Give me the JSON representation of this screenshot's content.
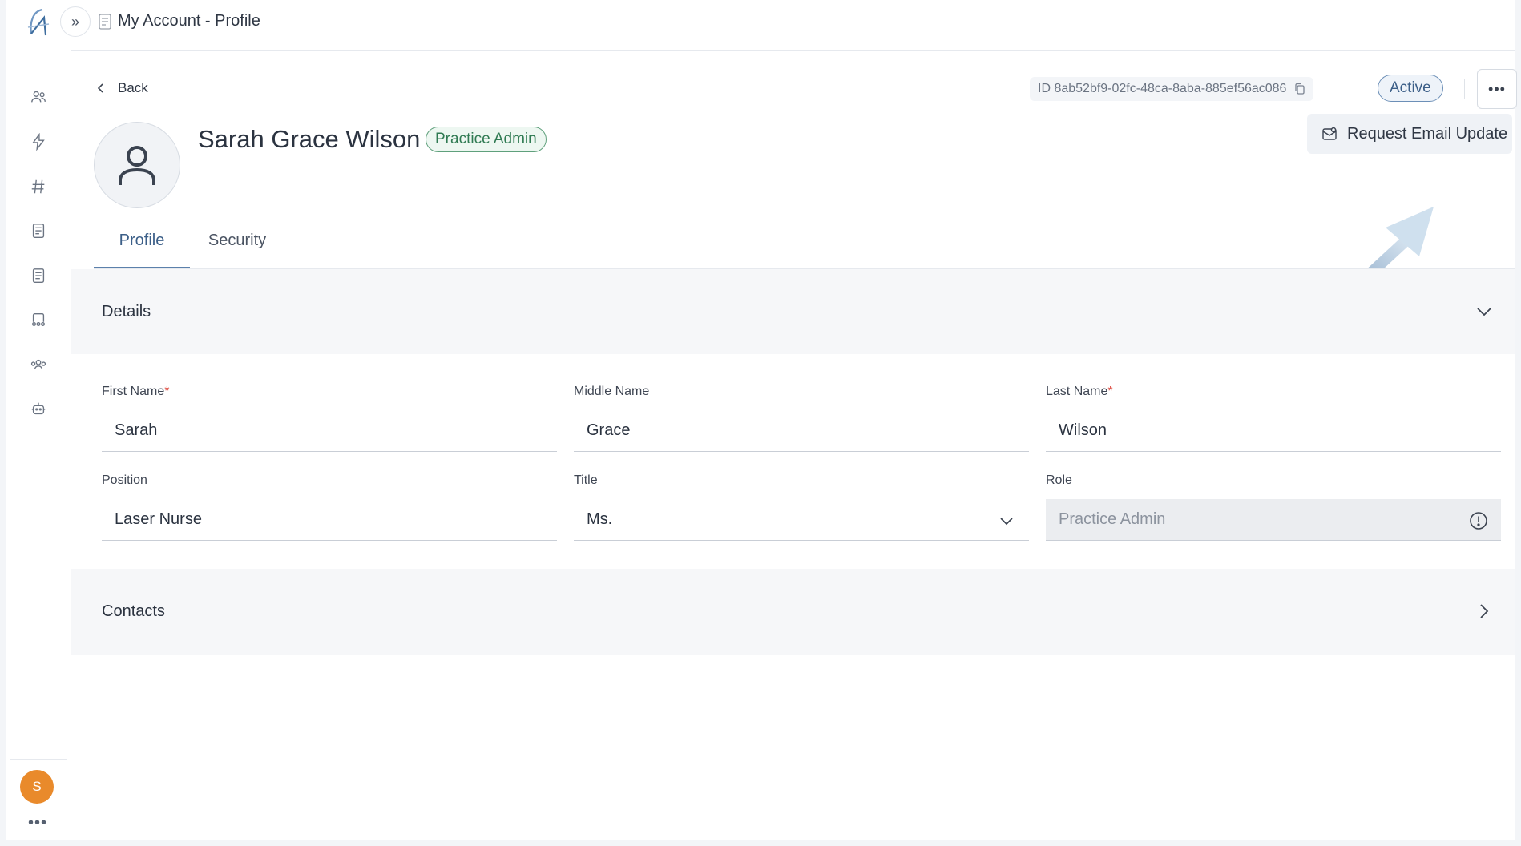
{
  "header": {
    "expand_icon": "»",
    "page_title": "My Account - Profile"
  },
  "sidebar": {
    "items": [
      {
        "icon": "users-icon"
      },
      {
        "icon": "bolt-icon"
      },
      {
        "icon": "hash-icon"
      },
      {
        "icon": "notebook-icon"
      },
      {
        "icon": "document-icon"
      },
      {
        "icon": "inbox-group-icon"
      },
      {
        "icon": "team-icon"
      },
      {
        "icon": "robot-icon"
      }
    ],
    "user_initial": "S",
    "more_label": "•••"
  },
  "toolbar": {
    "back_label": "Back",
    "id_text": "ID 8ab52bf9-02fc-48ca-8aba-885ef56ac086",
    "status": "Active",
    "more_label": "•••",
    "menu_item": "Request Email Update"
  },
  "profile": {
    "name": "Sarah Grace Wilson",
    "role_badge": "Practice Admin"
  },
  "tabs": [
    {
      "label": "Profile",
      "active": true
    },
    {
      "label": "Security",
      "active": false
    }
  ],
  "details": {
    "title": "Details",
    "fields": {
      "first_name": {
        "label": "First Name",
        "required": "*",
        "value": "Sarah"
      },
      "middle_name": {
        "label": "Middle Name",
        "value": "Grace"
      },
      "last_name": {
        "label": "Last Name",
        "required": "*",
        "value": "Wilson"
      },
      "position": {
        "label": "Position",
        "value": "Laser Nurse"
      },
      "title": {
        "label": "Title",
        "value": "Ms."
      },
      "role": {
        "label": "Role",
        "value": "Practice Admin"
      }
    }
  },
  "contacts": {
    "title": "Contacts"
  },
  "colors": {
    "accent": "#5b80ab",
    "active_status": "#3c5f88",
    "role_badge": "#2f7a52",
    "avatar": "#e98a2b"
  }
}
